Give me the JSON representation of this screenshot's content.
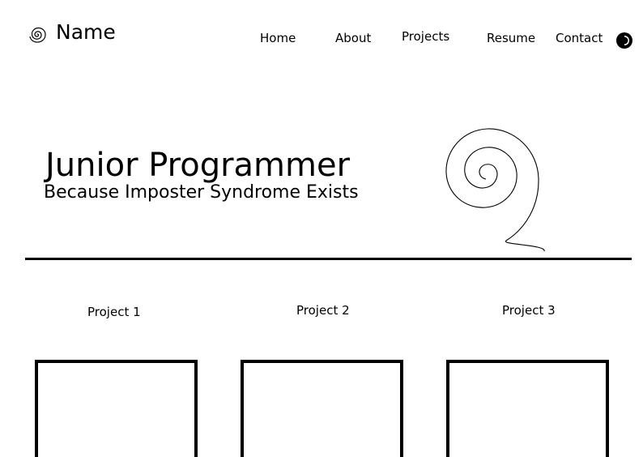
{
  "header": {
    "brand_name": "Name",
    "logo_icon": "spiral-icon",
    "nav": [
      {
        "label": "Home"
      },
      {
        "label": "About"
      },
      {
        "label": "Projects"
      },
      {
        "label": "Resume"
      },
      {
        "label": "Contact"
      }
    ],
    "theme_toggle_icon": "half-moon-contrast-icon"
  },
  "hero": {
    "title": "Junior Programmer",
    "subtitle": "Because Imposter Syndrome Exists",
    "illustration_icon": "spiral-icon"
  },
  "projects": [
    {
      "label": "Project 1"
    },
    {
      "label": "Project 2"
    },
    {
      "label": "Project 3"
    }
  ],
  "colors": {
    "background": "#ffffff",
    "foreground": "#000000"
  }
}
